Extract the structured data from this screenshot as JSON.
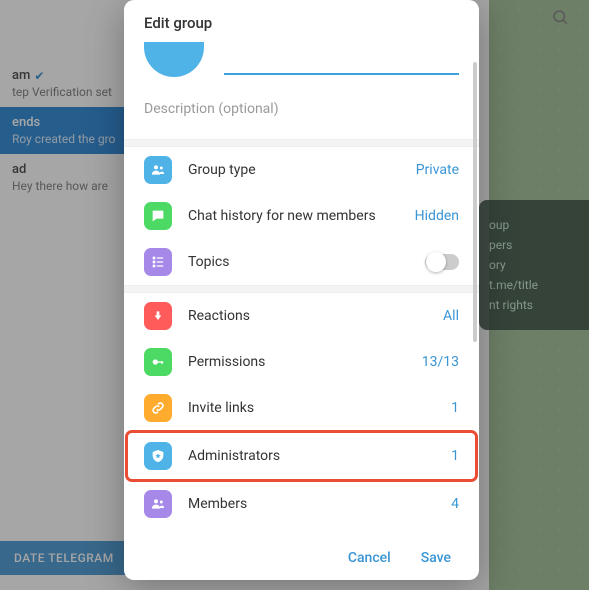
{
  "background": {
    "left_items": [
      {
        "title": "am",
        "sub": "tep Verification set",
        "verified": true,
        "highlight": false
      },
      {
        "title": "ends",
        "sub": "Roy created the gro",
        "highlight": true
      },
      {
        "title": "ad",
        "sub": "Hey there how are",
        "highlight": false
      }
    ],
    "right_panel": [
      "oup",
      "pers",
      "ory",
      "t.me/title",
      "nt rights"
    ],
    "update_button": "DATE TELEGRAM"
  },
  "modal": {
    "title": "Edit group",
    "description_placeholder": "Description (optional)",
    "sections": {
      "group_type": {
        "label": "Group type",
        "value": "Private",
        "icon_color": "#4fb3e8"
      },
      "chat_history": {
        "label": "Chat history for new members",
        "value": "Hidden",
        "icon_color": "#4cd964"
      },
      "topics": {
        "label": "Topics",
        "icon_color": "#a688e8"
      }
    },
    "management": {
      "reactions": {
        "label": "Reactions",
        "value": "All",
        "icon_color": "#ff5b5b"
      },
      "permissions": {
        "label": "Permissions",
        "value": "13/13",
        "icon_color": "#4cd964"
      },
      "invite_links": {
        "label": "Invite links",
        "value": "1",
        "icon_color": "#ffab2e"
      },
      "administrators": {
        "label": "Administrators",
        "value": "1",
        "icon_color": "#4fb3e8"
      },
      "members": {
        "label": "Members",
        "value": "4",
        "icon_color": "#a688e8"
      }
    },
    "footer": {
      "cancel": "Cancel",
      "save": "Save"
    }
  }
}
